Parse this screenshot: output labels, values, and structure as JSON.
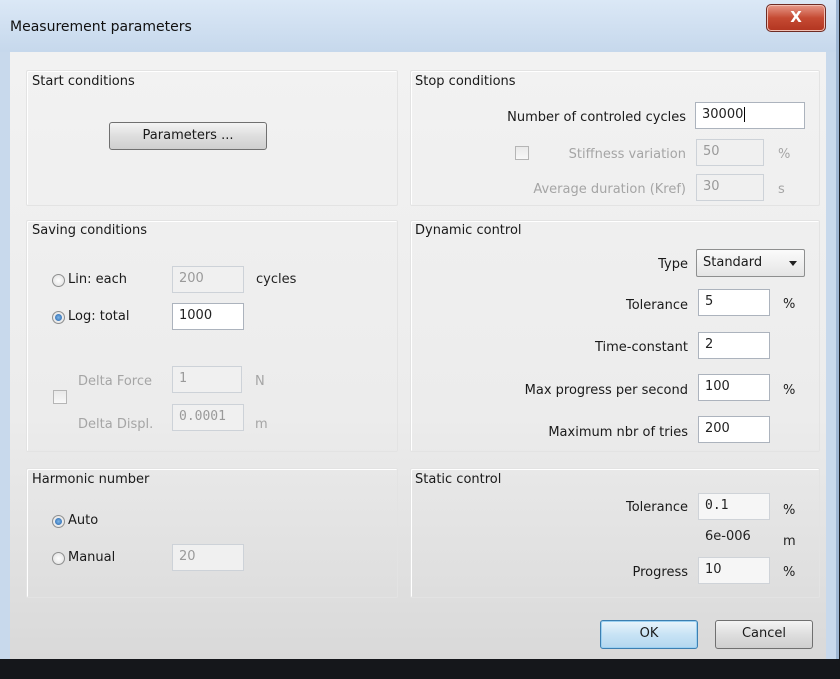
{
  "window": {
    "title": "Measurement parameters",
    "close_label": "X"
  },
  "start_conditions": {
    "title": "Start conditions",
    "parameters_button": "Parameters ..."
  },
  "stop_conditions": {
    "title": "Stop conditions",
    "cycles_label": "Number of controled cycles",
    "cycles_value": "30000",
    "stiffness_label": "Stiffness variation",
    "stiffness_value": "50",
    "stiffness_unit": "%",
    "duration_label": "Average duration (Kref)",
    "duration_value": "30",
    "duration_unit": "s"
  },
  "saving_conditions": {
    "title": "Saving conditions",
    "lin_label": "Lin: each",
    "lin_value": "200",
    "lin_unit": "cycles",
    "log_label": "Log: total",
    "log_value": "1000",
    "delta_force_label": "Delta Force",
    "delta_force_value": "1",
    "delta_force_unit": "N",
    "delta_displ_label": "Delta Displ.",
    "delta_displ_value": "0.0001",
    "delta_displ_unit": "m"
  },
  "dynamic_control": {
    "title": "Dynamic control",
    "type_label": "Type",
    "type_value": "Standard",
    "tolerance_label": "Tolerance",
    "tolerance_value": "5",
    "tolerance_unit": "%",
    "time_constant_label": "Time-constant",
    "time_constant_value": "2",
    "max_progress_label": "Max progress per second",
    "max_progress_value": "100",
    "max_progress_unit": "%",
    "max_tries_label": "Maximum nbr of tries",
    "max_tries_value": "200"
  },
  "harmonic_number": {
    "title": "Harmonic number",
    "auto_label": "Auto",
    "manual_label": "Manual",
    "manual_value": "20"
  },
  "static_control": {
    "title": "Static control",
    "tolerance_label": "Tolerance",
    "tolerance_value": "0.1",
    "tolerance_unit": "%",
    "tolerance_m_value": "6e-006",
    "tolerance_m_unit": "m",
    "progress_label": "Progress",
    "progress_value": "10",
    "progress_unit": "%"
  },
  "buttons": {
    "ok": "OK",
    "cancel": "Cancel"
  }
}
